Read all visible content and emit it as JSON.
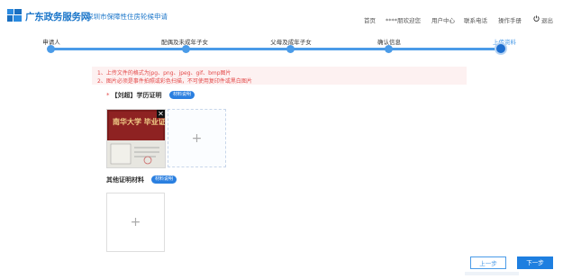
{
  "header": {
    "brand": "广东政务服务网",
    "subtitle": "深圳市保障性住房轮候申请",
    "nav": {
      "home": "首页",
      "welcome": "****朋欢迎您",
      "user_center": "用户中心",
      "contact": "联系电话",
      "manual": "操作手册",
      "logout": "退出"
    },
    "logo_icon": "guangdong-gov-logo-icon",
    "logout_icon": "power-icon",
    "accent_color": "#1a75c9"
  },
  "steps": [
    {
      "label": "申请人",
      "state": "done"
    },
    {
      "label": "配偶及未成年子女",
      "state": "done"
    },
    {
      "label": "父母及成年子女",
      "state": "done"
    },
    {
      "label": "确认信息",
      "state": "done"
    },
    {
      "label": "上传资料",
      "state": "current"
    }
  ],
  "notice": {
    "line1": "1、上传文件的格式为jpg、png、jpeg、gif、bmp图片",
    "line2": "2、图片必须是事件拍照或彩色扫描，不可使用复印件或黑白图片",
    "color": "#e34a4a"
  },
  "sections": {
    "education": {
      "required_mark": "*",
      "title": "【刘超】学历证明",
      "badge": "材料说明",
      "thumbnail_text": "南华大学 毕业证书",
      "close_label": "✕",
      "add_label": "+"
    },
    "other": {
      "title": "其他证明材料",
      "badge": "材料说明",
      "add_label": "+"
    }
  },
  "buttons": {
    "prev": "上一步",
    "next": "下一步",
    "primary_color": "#1e7fe0"
  }
}
